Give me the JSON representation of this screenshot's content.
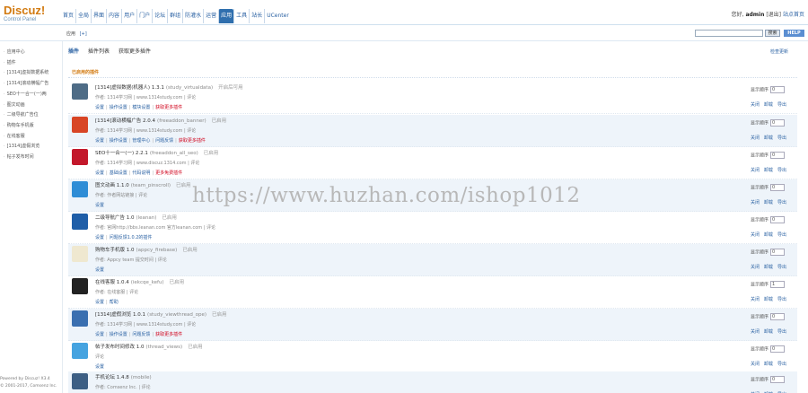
{
  "app": {
    "logo": "Discuz!",
    "logo_sub": "Control Panel"
  },
  "topnav": [
    "首页",
    "全局",
    "界面",
    "内容",
    "用户",
    "门户",
    "论坛",
    "群组",
    "防灌水",
    "运营",
    "应用",
    "工具",
    "站长",
    "UCenter"
  ],
  "topnav_active": 10,
  "user": {
    "prefix": "您好,",
    "name": "admin",
    "logout": "[退出]",
    "site_home": "站点首页"
  },
  "subbar": {
    "crumb": "应用",
    "crumb_add": "[+]",
    "search_button": "搜索",
    "help_button": "HELP"
  },
  "sidebar": {
    "items": [
      "应用中心",
      "插件",
      "[1314]虚拟数据系统",
      "[1314]滚动横幅广告",
      "SEO十一合一(一)两",
      "图文动画",
      "二级导航广告位",
      "购物车手机版",
      "在线客服",
      "[1314]虚假浏览",
      "帖子发布时间"
    ],
    "footer": [
      "Powered by Discuz! X3.4",
      "© 2001-2017, Comsenz Inc."
    ]
  },
  "main": {
    "tabs": [
      "插件",
      "插件列表",
      "获取更多插件"
    ],
    "update_link": "检查更新",
    "section_title": "已启用的插件",
    "order_label": "显示顺序",
    "ops": [
      "关闭",
      "卸载",
      "导出"
    ],
    "plugins": [
      {
        "name": "[1314]虚拟数据(机器人) 1.3.1",
        "dir": "(study_virtualdata)",
        "state": "开启后可用",
        "author": "作者: 1314学习网 | www.1314study.com | 评论",
        "actions": [
          "设置",
          "操作设置",
          "模块设置",
          "获取更多插件"
        ],
        "order": "0",
        "icon": "#4e6c86"
      },
      {
        "name": "[1314]滚动横幅广告 2.0.4",
        "dir": "(freeaddon_banner)",
        "state": "已启用",
        "author": "作者: 1314学习网 | www.1314study.com | 评论",
        "actions": [
          "设置",
          "操作设置",
          "管理中心",
          "问题反馈",
          "获取更多插件"
        ],
        "order": "0",
        "icon": "#d84525"
      },
      {
        "name": "SEO十一合一(一) 2.2.1",
        "dir": "(freeaddon_all_seo)",
        "state": "已启用",
        "author": "作者: 1314学习网 | www.discuz.1314.com | 评论",
        "actions": [
          "设置",
          "基础设置",
          "代码说明",
          "更多免费插件"
        ],
        "order": "0",
        "icon": "#c3182b"
      },
      {
        "name": "图文动画 1.1.0",
        "dir": "(team_pinscroll)",
        "state": "已启用",
        "author": "作者: 作者网站链接 | 评论",
        "actions": [
          "设置"
        ],
        "order": "0",
        "icon": "#2f8dd6"
      },
      {
        "name": "二级导航广告 1.0",
        "dir": "(leanan)",
        "state": "已启用",
        "author": "作者: 官网http://bbs.leanan.com 官方leanan.com | 评论",
        "actions": [
          "设置",
          "问题反馈1.0.2的插件"
        ],
        "order": "0",
        "icon": "#1f5ea8"
      },
      {
        "name": "购物车手机版 1.0",
        "dir": "(appcy_firebase)",
        "state": "已启用",
        "author": "作者: Appcy team 提交时间 | 评论",
        "actions": [
          "设置"
        ],
        "order": "0",
        "icon": "#efe8d0"
      },
      {
        "name": "在线客服 1.0.4",
        "dir": "(iekcqe_kefu)",
        "state": "已启用",
        "author": "作者: 在线客服 | 评论",
        "actions": [
          "设置",
          "帮助"
        ],
        "order": "1",
        "icon": "#222222"
      },
      {
        "name": "[1314]虚假浏览 1.0.1",
        "dir": "(study_viewthread_ope)",
        "state": "已启用",
        "author": "作者: 1314学习网 | www.1314study.com | 评论",
        "actions": [
          "设置",
          "操作设置",
          "问题反馈",
          "获取更多插件"
        ],
        "order": "0",
        "icon": "#3a6fb0"
      },
      {
        "name": "帖子发布时间修改 1.0",
        "dir": "(thread_views)",
        "state": "已启用",
        "author": "评论",
        "actions": [
          "设置"
        ],
        "order": "0",
        "icon": "#45a3e0"
      },
      {
        "name": "手机论坛 1.4.8",
        "dir": "(mobile)",
        "state": "",
        "author": "作者: Comsenz Inc. | 评论",
        "actions": [],
        "order": "0",
        "icon": "#3d5f84"
      }
    ]
  },
  "watermark": "https://www.huzhan.com/ishop1012"
}
